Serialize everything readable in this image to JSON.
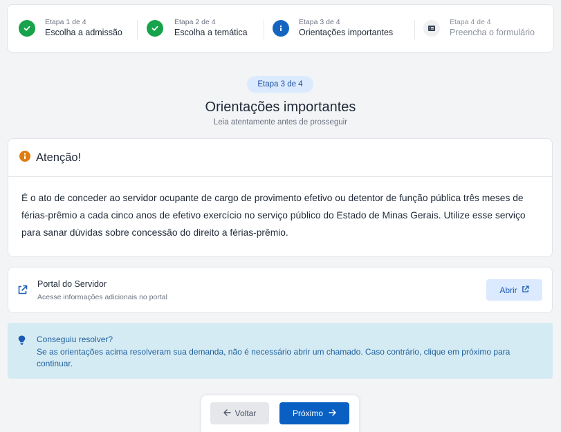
{
  "stepper": {
    "steps": [
      {
        "small": "Etapa 1 de 4",
        "label": "Escolha a admissão",
        "state": "done"
      },
      {
        "small": "Etapa 2 de 4",
        "label": "Escolha a temática",
        "state": "done"
      },
      {
        "small": "Etapa 3 de 4",
        "label": "Orientações importantes",
        "state": "current"
      },
      {
        "small": "Etapa 4 de 4",
        "label": "Preencha o formulário",
        "state": "pending"
      }
    ]
  },
  "header": {
    "badge": "Etapa 3 de 4",
    "title": "Orientações importantes",
    "subtitle": "Leia atentamente antes de prosseguir"
  },
  "attention": {
    "title": "Atenção!",
    "body": "É o ato de conceder ao servidor ocupante de cargo de provimento efetivo ou detentor de função pública três meses de férias-prêmio a cada cinco anos de efetivo exercício no serviço público do Estado de Minas Gerais. Utilize esse serviço para sanar dúvidas sobre concessão do direito a férias-prêmio."
  },
  "portal": {
    "title": "Portal do Servidor",
    "description": "Acesse informações adicionais no portal",
    "button_label": "Abrir"
  },
  "tip": {
    "title": "Conseguiu resolver?",
    "text": "Se as orientações acima resolveram sua demanda, não é necessário abrir um chamado. Caso contrário, clique em próximo para continuar."
  },
  "nav": {
    "back_label": "Voltar",
    "next_label": "Próximo"
  },
  "icons": {
    "step_done": "check-icon",
    "step_current": "info-icon",
    "step_pending": "list-icon",
    "attention": "warning-info-icon",
    "portal": "external-link-icon",
    "tip": "lightbulb-icon"
  },
  "colors": {
    "success": "#16a34a",
    "primary": "#0a60c2",
    "warning": "#e07b0f",
    "tip_bg": "#d5ebf3"
  }
}
